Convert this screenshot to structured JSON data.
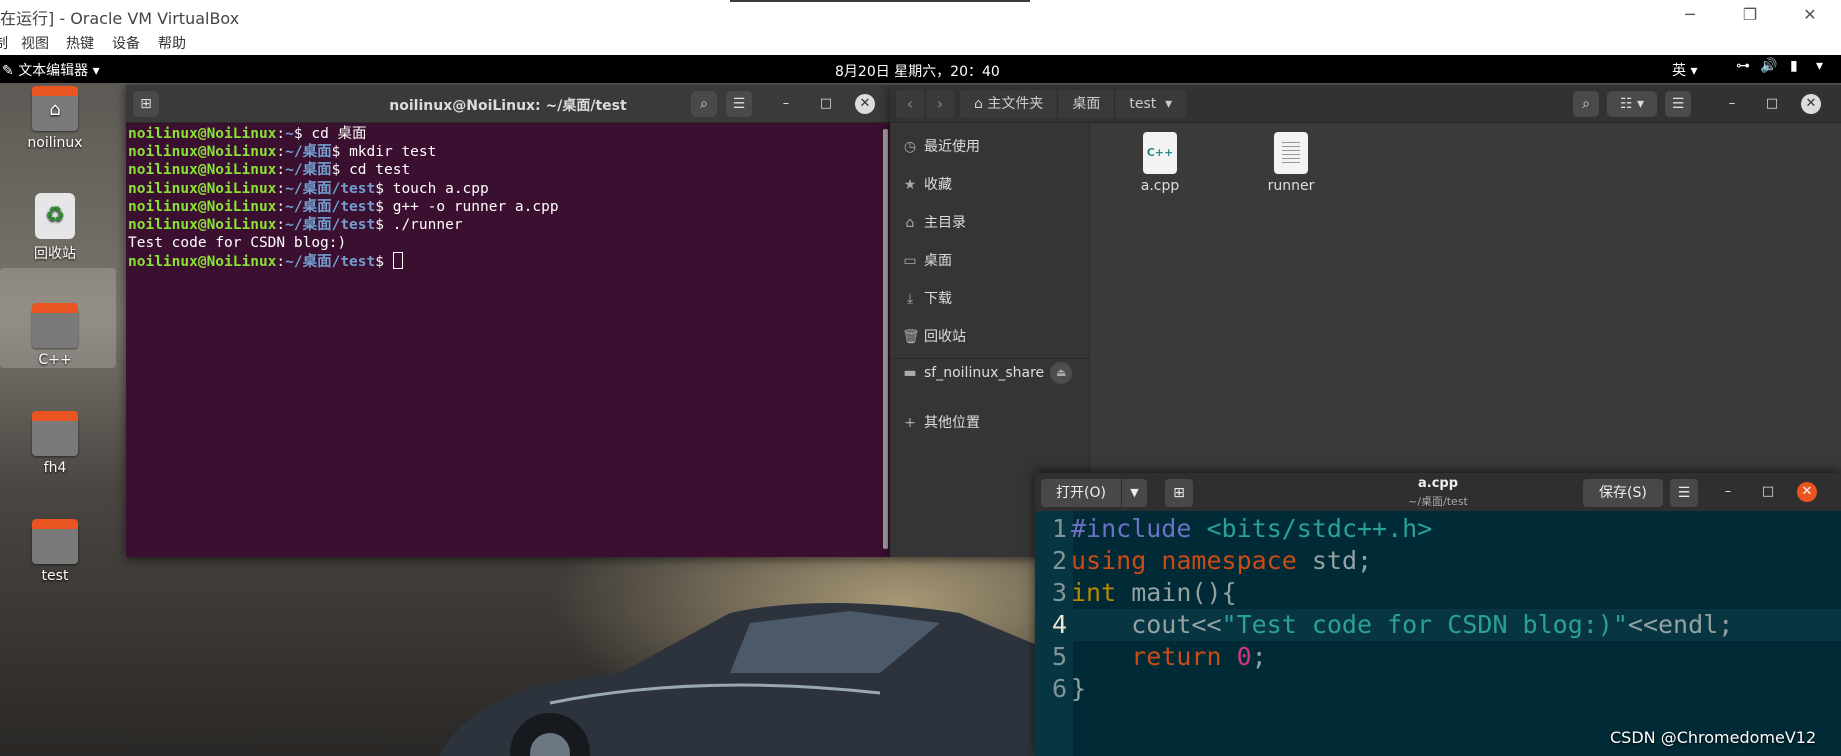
{
  "host": {
    "title": "在运行] - Oracle VM VirtualBox",
    "menu": [
      "制",
      "视图",
      "热键",
      "设备",
      "帮助"
    ],
    "controls": {
      "minimize": "─",
      "restore": "❐",
      "close": "✕"
    }
  },
  "topbar": {
    "app_menu": "文本编辑器 ▾",
    "clock": "8月20日 星期六，20：40",
    "ime": "英 ▾",
    "tray_icons": [
      "network-icon",
      "volume-icon",
      "battery-icon",
      "menu-arrow-icon"
    ]
  },
  "desktop": {
    "icons": [
      {
        "label": "noilinux",
        "icon": "home-folder-icon"
      },
      {
        "label": "回收站",
        "icon": "trash-icon"
      },
      {
        "label": "C++",
        "icon": "folder-icon"
      },
      {
        "label": "fh4",
        "icon": "folder-icon"
      },
      {
        "label": "test",
        "icon": "folder-icon"
      }
    ]
  },
  "terminal": {
    "title": "noilinux@NoiLinux: ~/桌面/test",
    "user": "noilinux@NoiLinux",
    "lines": [
      {
        "path": "~",
        "cmd": "cd 桌面"
      },
      {
        "path": "~/桌面",
        "cmd": "mkdir test"
      },
      {
        "path": "~/桌面",
        "cmd": "cd test"
      },
      {
        "path": "~/桌面/test",
        "cmd": "touch a.cpp"
      },
      {
        "path": "~/桌面/test",
        "cmd": "g++ -o runner a.cpp"
      },
      {
        "path": "~/桌面/test",
        "cmd": "./runner"
      }
    ],
    "output": "Test code for CSDN blog:)",
    "last_path": "~/桌面/test"
  },
  "files": {
    "breadcrumbs": [
      "主文件夹",
      "桌面",
      "test"
    ],
    "sidebar": [
      {
        "label": "最近使用",
        "icon": "clock-icon"
      },
      {
        "label": "收藏",
        "icon": "star-icon"
      },
      {
        "label": "主目录",
        "icon": "home-icon"
      },
      {
        "label": "桌面",
        "icon": "desktop-icon"
      },
      {
        "label": "下载",
        "icon": "download-icon"
      },
      {
        "label": "回收站",
        "icon": "trash-icon"
      },
      {
        "label": "sf_noilinux_share",
        "icon": "drive-icon"
      },
      {
        "label": "其他位置",
        "icon": "plus-icon"
      }
    ],
    "items": [
      {
        "name": "a.cpp",
        "type": "cpp"
      },
      {
        "name": "runner",
        "type": "binary"
      }
    ],
    "cpp_badge": "C++"
  },
  "editor": {
    "open_label": "打开(O)",
    "title": "a.cpp",
    "subtitle": "~/桌面/test",
    "save_label": "保存(S)",
    "current_line": 4,
    "code": [
      "#include <bits/stdc++.h>",
      "using namespace std;",
      "int main(){",
      "    cout<<\"Test code for CSDN blog:)\"<<endl;",
      "    return 0;",
      "}"
    ]
  },
  "watermark": "CSDN @ChromedomeV12",
  "colors": {
    "terminal_bg": "#3b0f30",
    "prompt_user": "#8ae234",
    "prompt_path": "#729fcf",
    "editor_bg": "#002b36",
    "ubuntu_orange": "#e95420"
  }
}
